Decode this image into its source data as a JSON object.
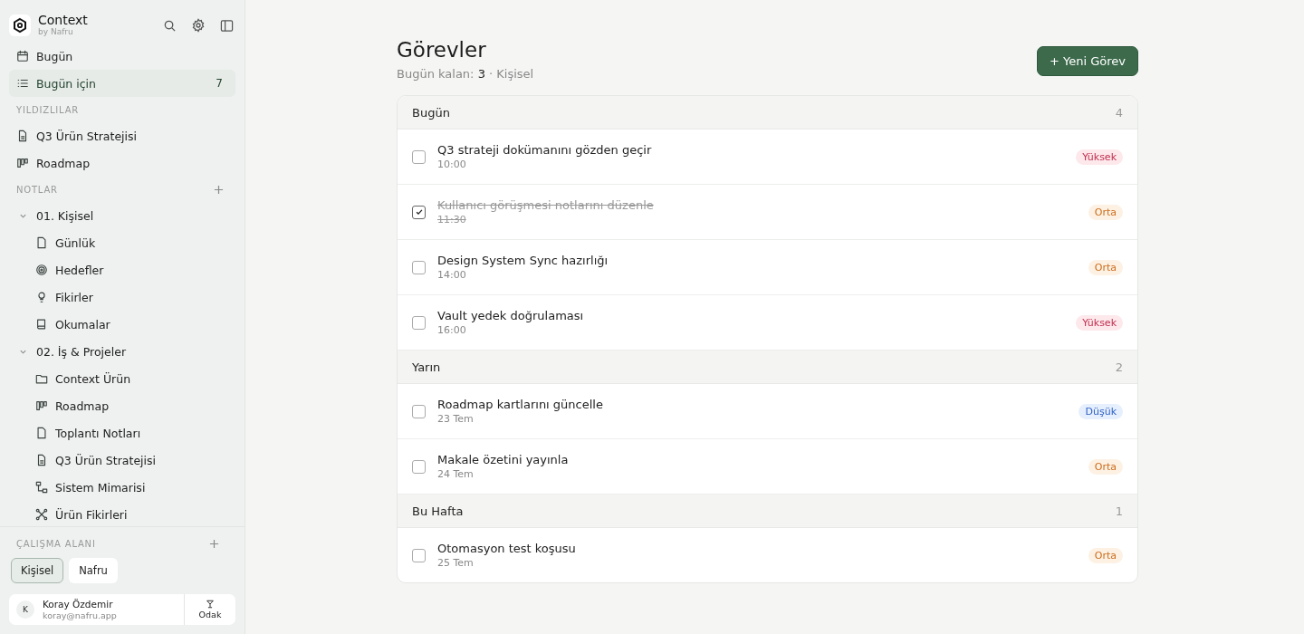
{
  "brand": {
    "name": "Context",
    "tagline": "by Nafru"
  },
  "nav": [
    {
      "label": "Bugün",
      "kind": "calendar",
      "selected": false
    },
    {
      "label": "Bugün için",
      "kind": "list",
      "selected": true,
      "count": "7"
    }
  ],
  "starred": {
    "title": "YILDIZLILAR",
    "items": [
      {
        "label": "Q3 Ürün Stratejisi",
        "kind": "doc"
      },
      {
        "label": "Roadmap",
        "kind": "board"
      }
    ]
  },
  "notes": {
    "title": "NOTLAR",
    "tree": [
      {
        "label": "01. Kişisel",
        "expanded": true,
        "children": [
          {
            "label": "Günlük",
            "kind": "file"
          },
          {
            "label": "Hedefler",
            "kind": "target"
          },
          {
            "label": "Fikirler",
            "kind": "bulb"
          },
          {
            "label": "Okumalar",
            "kind": "book"
          }
        ]
      },
      {
        "label": "02. İş & Projeler",
        "expanded": true,
        "children": [
          {
            "label": "Context Ürün",
            "kind": "folder"
          },
          {
            "label": "Roadmap",
            "kind": "board"
          },
          {
            "label": "Toplantı Notları",
            "kind": "file"
          },
          {
            "label": "Q3 Ürün Stratejisi",
            "kind": "doc"
          },
          {
            "label": "Sistem Mimarisi",
            "kind": "diagram"
          },
          {
            "label": "Ürün Fikirleri",
            "kind": "nodes"
          }
        ]
      }
    ]
  },
  "workspace": {
    "title": "ÇALIŞMA ALANI",
    "options": [
      {
        "label": "Kişisel",
        "selected": true
      },
      {
        "label": "Nafru",
        "selected": false
      }
    ]
  },
  "user": {
    "initial": "K",
    "name": "Koray Özdemir",
    "email": "koray@nafru.app",
    "focus_label": "Odak"
  },
  "page": {
    "title": "Görevler",
    "subtitle": "Bugün kalan: **3** · Kişisel",
    "new_button": "+ Yeni Görev"
  },
  "groups": [
    {
      "title": "Bugün",
      "count": "4",
      "tasks": [
        {
          "title": "Q3 strateji dokümanını gözden geçir",
          "time": "10:00",
          "checked": false,
          "kind": "high",
          "badge": "Yüksek"
        },
        {
          "title": "Kullanıcı görüşmesi notlarını düzenle",
          "time": "11:30",
          "checked": true,
          "kind": "medium",
          "badge": "Orta"
        },
        {
          "title": "Design System Sync hazırlığı",
          "time": "14:00",
          "checked": false,
          "kind": "medium",
          "badge": "Orta"
        },
        {
          "title": "Vault yedek doğrulaması",
          "time": "16:00",
          "checked": false,
          "kind": "high",
          "badge": "Yüksek"
        }
      ]
    },
    {
      "title": "Yarın",
      "count": "2",
      "tasks": [
        {
          "title": "Roadmap kartlarını güncelle",
          "time": "23 Tem",
          "checked": false,
          "kind": "low",
          "badge": "Düşük"
        },
        {
          "title": "Makale özetini yayınla",
          "time": "24 Tem",
          "checked": false,
          "kind": "medium",
          "badge": "Orta"
        }
      ]
    },
    {
      "title": "Bu Hafta",
      "count": "1",
      "tasks": [
        {
          "title": "Otomasyon test koşusu",
          "time": "25 Tem",
          "checked": false,
          "kind": "medium",
          "badge": "Orta"
        }
      ]
    }
  ]
}
